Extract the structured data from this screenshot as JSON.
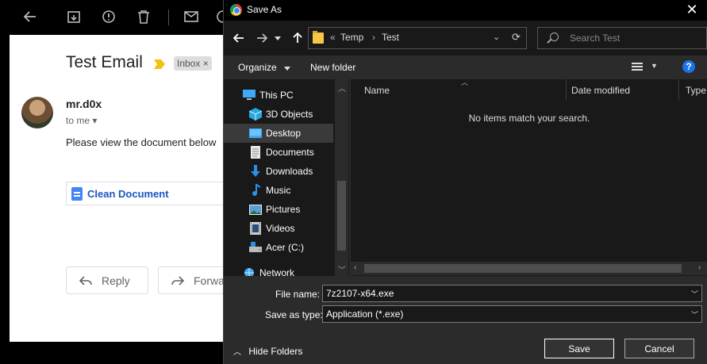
{
  "gmail": {
    "subject": "Test Email",
    "label_inbox": "Inbox",
    "label_remove": "×",
    "sender": "mr.d0x",
    "to_me": "to me",
    "to_me_arrow": "▾",
    "message": "Please view the document below",
    "attachment_name": "Clean Document",
    "reply_label": "Reply",
    "forward_label": "Forwa"
  },
  "dialog": {
    "title": "Save As",
    "close_glyph": "✕",
    "breadcrumb_prefix": "«",
    "breadcrumb": [
      "Temp",
      "Test"
    ],
    "search_placeholder": "Search Test",
    "organize_label": "Organize",
    "new_folder_label": "New folder",
    "help_glyph": "?",
    "nav_items": [
      {
        "label": "This PC",
        "icon": "this-pc-icon"
      },
      {
        "label": "3D Objects",
        "icon": "3d-objects-icon"
      },
      {
        "label": "Desktop",
        "icon": "desktop-icon"
      },
      {
        "label": "Documents",
        "icon": "documents-icon"
      },
      {
        "label": "Downloads",
        "icon": "downloads-icon"
      },
      {
        "label": "Music",
        "icon": "music-icon"
      },
      {
        "label": "Pictures",
        "icon": "pictures-icon"
      },
      {
        "label": "Videos",
        "icon": "videos-icon"
      },
      {
        "label": "Acer (C:)",
        "icon": "drive-icon"
      },
      {
        "label": "Network",
        "icon": "network-icon"
      }
    ],
    "selected_nav": "Desktop",
    "columns": [
      "Name",
      "Date modified",
      "Type"
    ],
    "empty_message": "No items match your search.",
    "file_name_label": "File name:",
    "file_name_value": "7z2107-x64.exe",
    "save_type_label": "Save as type:",
    "save_type_value": "Application (*.exe)",
    "hide_folders_label": "Hide Folders",
    "save_button": "Save",
    "cancel_button": "Cancel"
  },
  "colors": {
    "dialog_bg": "#2b2b2b",
    "pane_bg": "#191919",
    "link_blue": "#1a57c2",
    "help_blue": "#1a73e8",
    "folder_yellow": "#f5c64a"
  }
}
